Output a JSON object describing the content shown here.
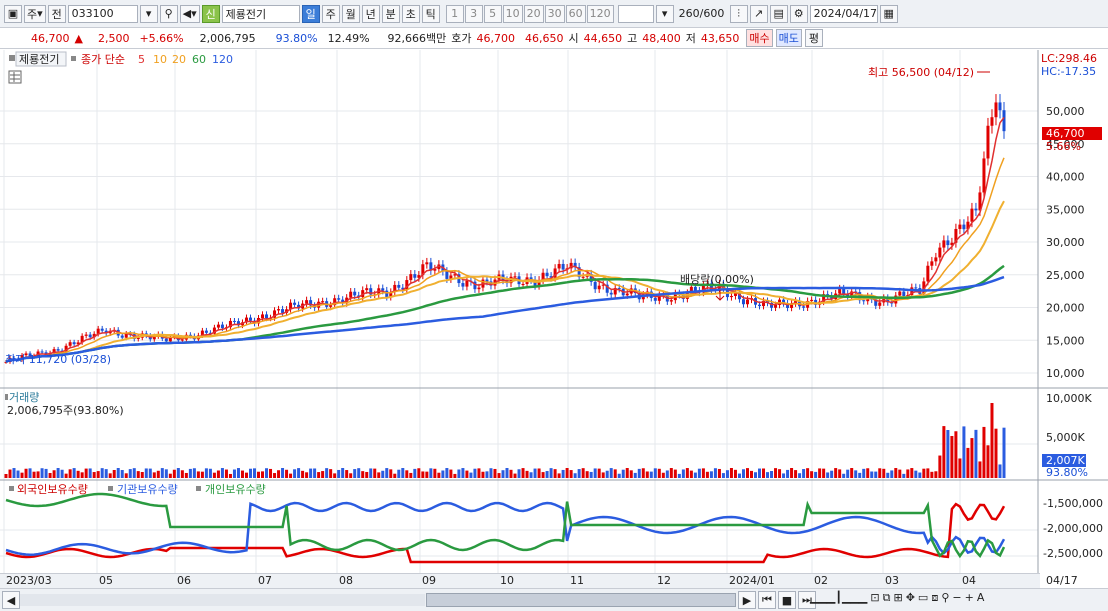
{
  "toolbar": {
    "market": "주",
    "prev": "전",
    "code": "033100",
    "badge": "신",
    "name": "제룡전기",
    "periods": [
      "일",
      "주",
      "월",
      "년",
      "분",
      "초",
      "틱"
    ],
    "active_period": "일",
    "intervals": [
      "1",
      "3",
      "5",
      "10",
      "20",
      "30",
      "60",
      "120"
    ],
    "count": "260",
    "count_max": "/600",
    "date": "2024/04/17"
  },
  "quote": {
    "price": "46,700",
    "change": "2,500",
    "rate": "+5.66%",
    "volume": "2,006,795",
    "vol_rate": "93.80%",
    "turnover": "12.49%",
    "amount": "92,666백만",
    "ask_label": "호가",
    "ask": "46,700",
    "bid": "46,650",
    "open_label": "시",
    "open": "44,650",
    "high_label": "고",
    "high": "48,400",
    "low_label": "저",
    "low": "43,650",
    "buy": "매수",
    "sell": "매도",
    "avg": "평"
  },
  "legend": {
    "name": "제룡전기",
    "close": "종가 단순",
    "ma": [
      "5",
      "10",
      "20",
      "60",
      "120"
    ]
  },
  "price_axis": {
    "ticks": [
      "50,000",
      "45,000",
      "40,000",
      "35,000",
      "30,000",
      "25,000",
      "20,000",
      "15,000",
      "10,000"
    ],
    "lc": "LC:298.46",
    "hc": "HC:-17.35",
    "cur": "46,700",
    "cur_rate": "5.66%"
  },
  "annotations": {
    "high": "최고 56,500 (04/12)",
    "low": "최저 11,720 (03/28)",
    "dividend": "배당락(0.00%)"
  },
  "volume_panel": {
    "title": "거래량",
    "value": "2,006,795주(93.80%)",
    "ticks": [
      "10,000K",
      "5,000K"
    ],
    "cur": "2,007K",
    "cur_rate": "93.80%"
  },
  "holding_panel": {
    "series": [
      "외국인보유수량",
      "기관보유수량",
      "개인보유수량"
    ],
    "ticks": [
      "-1,500,000",
      "-2,000,000",
      "-2,500,000"
    ]
  },
  "x_axis": {
    "labels": [
      "2023/03",
      "05",
      "06",
      "07",
      "08",
      "09",
      "10",
      "11",
      "12",
      "2024/01",
      "02",
      "03",
      "04"
    ],
    "last": "04/17"
  },
  "colors": {
    "red": "#e00000",
    "blue": "#2b5ce0",
    "green": "#2a9a40",
    "orange": "#f0a020",
    "ma5": "#e03030",
    "ma10": "#f0a020",
    "ma20": "#2a9a40",
    "ma60": "#2b5ce0"
  }
}
